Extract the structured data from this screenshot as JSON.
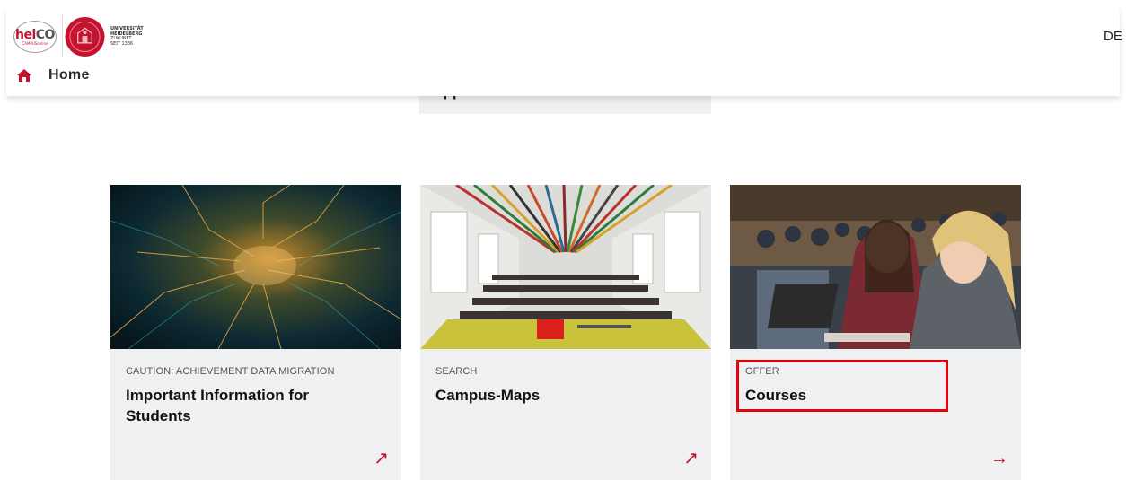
{
  "header": {
    "logo_text_he": "hei",
    "logo_text_co": "CO",
    "logo_sub": "CAMPUSonline",
    "university_line1": "UNIVERSITÄT",
    "university_line2": "HEIDELBERG",
    "university_line3": "ZUKUNFT",
    "university_line4": "SEIT 1386",
    "language": "DE",
    "home_label": "Home"
  },
  "previous_card": {
    "title_fragment": "application here"
  },
  "cards": [
    {
      "kicker": "CAUTION: ACHIEVEMENT DATA MIGRATION",
      "title": "Important Information for Students",
      "arrow": "↗",
      "image": "circuit-board-image"
    },
    {
      "kicker": "SEARCH",
      "title": "Campus-Maps",
      "arrow": "↗",
      "image": "lecture-hall-image"
    },
    {
      "kicker": "OFFER",
      "title": "Courses",
      "arrow": "→",
      "image": "students-image"
    }
  ],
  "colors": {
    "brand_red": "#c4122f",
    "card_bg": "#eef0f1",
    "highlight_red": "#e3000f"
  }
}
